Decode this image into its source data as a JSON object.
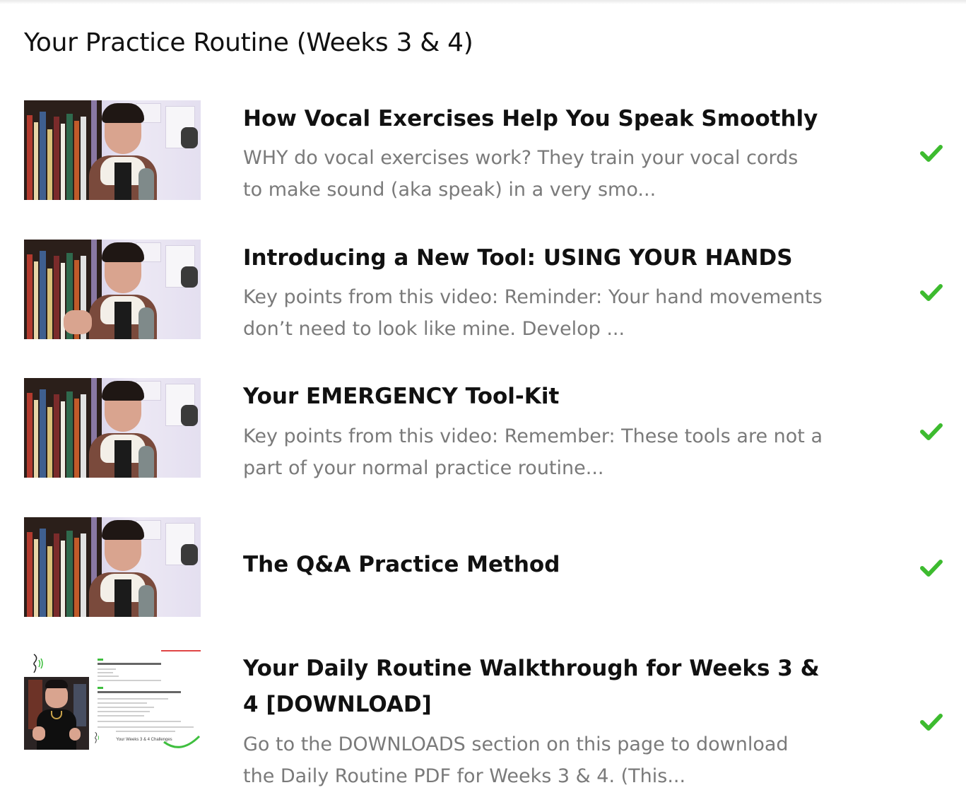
{
  "section": {
    "title": "Your Practice Routine (Weeks 3 & 4)"
  },
  "lessons": [
    {
      "title": "How Vocal Exercises Help You Speak Smoothly",
      "description": "WHY do vocal exercises work? They train your vocal cords to make sound (aka speak) in a very smo...",
      "completed_icon": "checkmark-icon",
      "thumbnail_icon": "video-thumbnail"
    },
    {
      "title": "Introducing a New Tool: USING YOUR HANDS",
      "description": "Key points from this video: Reminder: Your hand movements don’t need to look like mine. Develop ...",
      "completed_icon": "checkmark-icon",
      "thumbnail_icon": "video-thumbnail"
    },
    {
      "title": "Your EMERGENCY Tool-Kit",
      "description": "Key points from this video: Remember: These tools are not a part of your normal practice routine...",
      "completed_icon": "checkmark-icon",
      "thumbnail_icon": "video-thumbnail"
    },
    {
      "title": "The Q&A Practice Method",
      "description": "",
      "completed_icon": "checkmark-icon",
      "thumbnail_icon": "video-thumbnail"
    },
    {
      "title": "Your Daily Routine Walkthrough for Weeks 3 & 4 [DOWNLOAD]",
      "description": "Go to the DOWNLOADS section on this page to download the Daily Routine PDF for Weeks 3 & 4. (This...",
      "completed_icon": "checkmark-icon",
      "thumbnail_icon": "document-thumbnail",
      "thumbnail_caption": "Your Weeks 3 & 4 Challenges"
    }
  ],
  "colors": {
    "check": "#3dbb2f",
    "description": "#7a7a7a",
    "title": "#111111"
  }
}
